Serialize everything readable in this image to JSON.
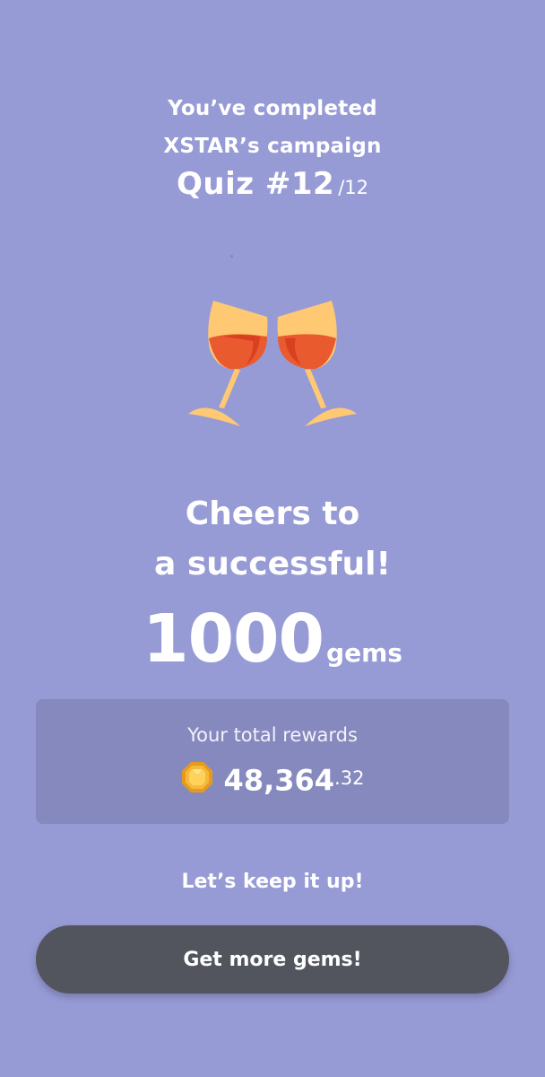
{
  "header": {
    "line1": "You’ve completed",
    "line2": "XSTAR’s campaign",
    "quiz_title": "Quiz #12",
    "quiz_total": "/12"
  },
  "illustration": {
    "icon": "wine-glasses-cheers-icon"
  },
  "message": {
    "line1": "Cheers to",
    "line2": "a successful!"
  },
  "reward": {
    "amount": "1000",
    "unit": "gems"
  },
  "rewards_card": {
    "label": "Your total rewards",
    "icon": "gem-icon",
    "value_main": "48,364",
    "value_decimal": ".32"
  },
  "footer": {
    "encouragement": "Let’s keep it up!",
    "button_label": "Get more gems!"
  },
  "colors": {
    "background": "#979bd5",
    "card": "#8689be",
    "button": "#53555e",
    "text": "#ffffff",
    "gem": "#f5b93a",
    "wine": "#ea5a2f",
    "glass": "#ffc974"
  }
}
